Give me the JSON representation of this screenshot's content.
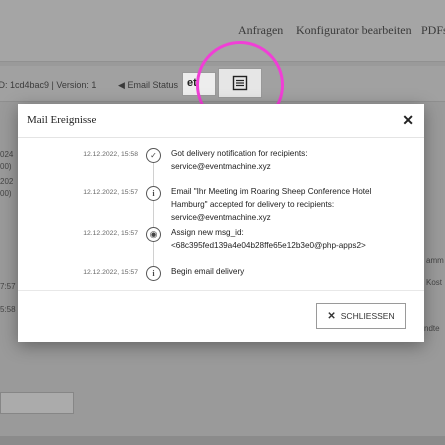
{
  "background": {
    "nav": [
      "Anfragen",
      "Konfigurator bearbeiten",
      "PDFs"
    ],
    "subbar_text": "ID: 1cd4bac9 | Version: 1",
    "email_status_label": "Email Status",
    "highlight_button_text": "et",
    "sidebar_fragments": [
      "024",
      "00)",
      "202",
      "00)",
      "7:57",
      "5:58"
    ],
    "right_fragments": [
      "amm",
      "Kost",
      "ndte"
    ]
  },
  "modal": {
    "title": "Mail Ereignisse",
    "close_label": "SCHLIESSEN",
    "events": [
      {
        "time": "12.12.2022, 15:58",
        "icon": "check-circle-icon",
        "lines": [
          "Got delivery notification for recipients:",
          "service@eventmachine.xyz"
        ]
      },
      {
        "time": "12.12.2022, 15:57",
        "icon": "info-circle-icon",
        "lines": [
          "Email \"Ihr Meeting im Roaring Sheep Conference Hotel",
          "Hamburg\" accepted for delivery to recipients:",
          "service@eventmachine.xyz"
        ]
      },
      {
        "time": "12.12.2022, 15:57",
        "icon": "dot-circle-icon",
        "lines": [
          "Assign new msg_id:",
          "<68c395fed139a4e04b28ffe65e12b3e0@php-apps2>"
        ]
      },
      {
        "time": "12.12.2022, 15:57",
        "icon": "info-circle-icon",
        "lines": [
          "Begin email delivery"
        ]
      }
    ]
  },
  "colors": {
    "highlight": "#f03fd6"
  }
}
